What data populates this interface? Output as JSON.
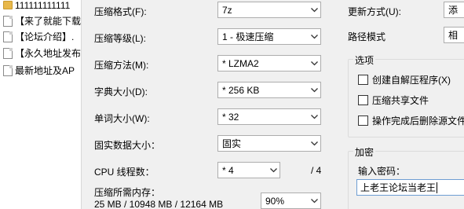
{
  "filelist": {
    "items": [
      {
        "label": "111111111111",
        "icon": "folder-icon"
      },
      {
        "label": "【来了就能下载",
        "icon": "file-icon"
      },
      {
        "label": "【论坛介绍】.",
        "icon": "file-icon"
      },
      {
        "label": "【永久地址发布",
        "icon": "file-icon"
      },
      {
        "label": "最新地址及AP",
        "icon": "file-icon"
      }
    ]
  },
  "settings": {
    "format_label": "压缩格式(F):",
    "format_value": "7z",
    "level_label": "压缩等级(L):",
    "level_value": "1 - 极速压缩",
    "method_label": "压缩方法(M):",
    "method_value": "* LZMA2",
    "dict_label": "字典大小(D):",
    "dict_value": "* 256 KB",
    "word_label": "单词大小(W):",
    "word_value": "* 32",
    "solid_label": "固实数据大小：",
    "solid_value": "固实",
    "threads_label": "CPU 线程数：",
    "threads_value": "* 4",
    "threads_total": "/ 4",
    "memory_label": "压缩所需内存：",
    "memory_values": "25 MB / 10948 MB / 12164 MB",
    "memory_percent": "90%"
  },
  "right": {
    "update_label": "更新方式(U):",
    "update_value": "添",
    "path_label": "路径模式",
    "path_value": "相",
    "options_title": "选项",
    "options": [
      "创建自解压程序(X)",
      "压缩共享文件",
      "操作完成后删除源文件"
    ],
    "encrypt_title": "加密",
    "password_label": "输入密码：",
    "password_value": "上老王论坛当老王"
  }
}
